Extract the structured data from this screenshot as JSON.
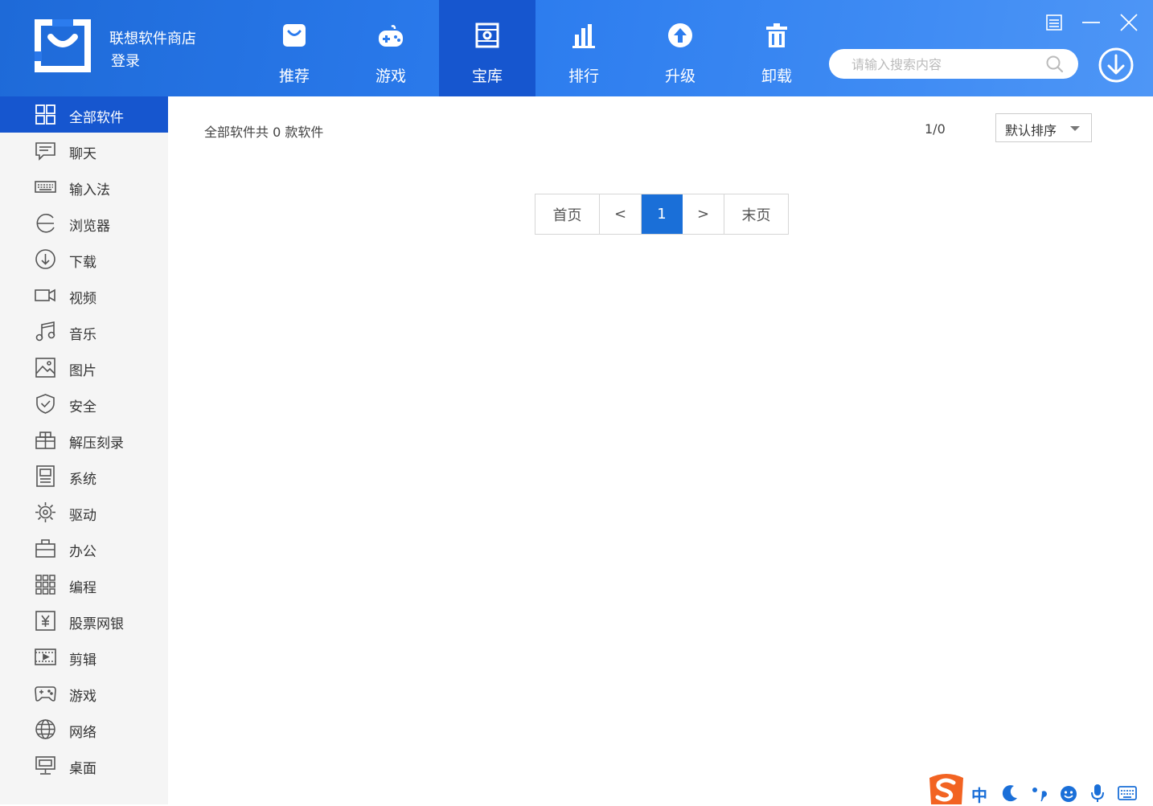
{
  "app": {
    "title": "联想软件商店",
    "login": "登录"
  },
  "nav": {
    "tabs": [
      {
        "label": "推荐",
        "icon": "bag-icon",
        "active": false
      },
      {
        "label": "游戏",
        "icon": "gamepad-icon",
        "active": false
      },
      {
        "label": "宝库",
        "icon": "treasure-box-icon",
        "active": true
      },
      {
        "label": "排行",
        "icon": "bar-chart-icon",
        "active": false
      },
      {
        "label": "升级",
        "icon": "upgrade-arrow-icon",
        "active": false
      },
      {
        "label": "卸载",
        "icon": "trash-icon",
        "active": false
      }
    ]
  },
  "search": {
    "placeholder": "请输入搜索内容",
    "value": ""
  },
  "sidebar": {
    "items": [
      {
        "label": "全部软件",
        "icon": "grid-icon",
        "active": true
      },
      {
        "label": "聊天",
        "icon": "chat-icon"
      },
      {
        "label": "输入法",
        "icon": "keyboard-icon"
      },
      {
        "label": "浏览器",
        "icon": "browser-icon"
      },
      {
        "label": "下载",
        "icon": "download-icon"
      },
      {
        "label": "视频",
        "icon": "video-camera-icon"
      },
      {
        "label": "音乐",
        "icon": "music-note-icon"
      },
      {
        "label": "图片",
        "icon": "picture-icon"
      },
      {
        "label": "安全",
        "icon": "shield-icon"
      },
      {
        "label": "解压刻录",
        "icon": "archive-icon"
      },
      {
        "label": "系统",
        "icon": "system-icon"
      },
      {
        "label": "驱动",
        "icon": "gear-icon"
      },
      {
        "label": "办公",
        "icon": "briefcase-icon"
      },
      {
        "label": "编程",
        "icon": "modules-icon"
      },
      {
        "label": "股票网银",
        "icon": "yuan-icon"
      },
      {
        "label": "剪辑",
        "icon": "film-icon"
      },
      {
        "label": "游戏",
        "icon": "gamepad-outline-icon"
      },
      {
        "label": "网络",
        "icon": "globe-icon"
      },
      {
        "label": "桌面",
        "icon": "monitor-icon"
      }
    ]
  },
  "content": {
    "total_text": "全部软件共 0 款软件",
    "page_indicator": "1/0",
    "sort": {
      "selected": "默认排序"
    }
  },
  "pagination": {
    "first": "首页",
    "prev": "<",
    "current": "1",
    "next": ">",
    "last": "末页"
  },
  "ime": {
    "mode": "中"
  },
  "colors": {
    "header_blue": "#2c7cee",
    "active_blue": "#1656cf",
    "page_active": "#1a6fd8",
    "sogou_orange": "#f26322"
  }
}
